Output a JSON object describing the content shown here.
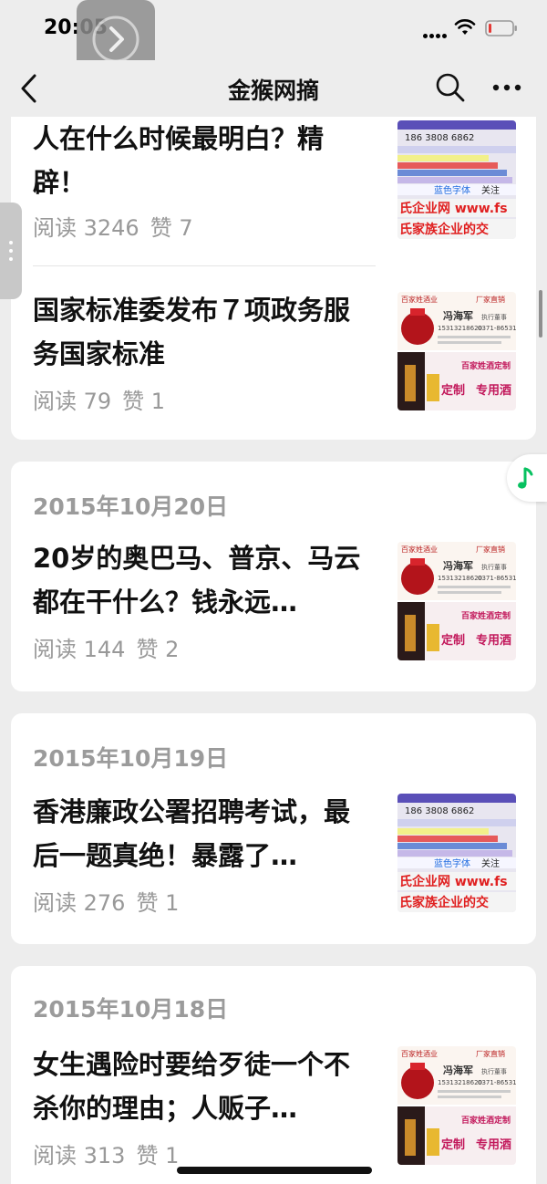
{
  "status": {
    "time": "20:05"
  },
  "nav": {
    "title": "金猴网摘"
  },
  "cards": [
    {
      "date": "",
      "articles": [
        {
          "title": "人在什么时候最明白？精辟！",
          "reads": "阅读 3246",
          "likes": "赞 7",
          "thumb": "ad-enterprise"
        },
        {
          "title": "国家标准委发布７项政务服务国家标准",
          "reads": "阅读 79",
          "likes": "赞 1",
          "thumb": "ad-liquor"
        }
      ]
    },
    {
      "date": "2015年10月20日",
      "articles": [
        {
          "title": "20岁的奥巴马、普京、马云都在干什么？钱永远…",
          "reads": "阅读 144",
          "likes": "赞 2",
          "thumb": "ad-liquor"
        }
      ]
    },
    {
      "date": "2015年10月19日",
      "articles": [
        {
          "title": "香港廉政公署招聘考试，最后一题真绝！暴露了…",
          "reads": "阅读 276",
          "likes": "赞 1",
          "thumb": "ad-enterprise"
        }
      ]
    },
    {
      "date": "2015年10月18日",
      "articles": [
        {
          "title": "女生遇险时要给歹徒一个不杀你的理由；人贩子…",
          "reads": "阅读 313",
          "likes": "赞 1",
          "thumb": "ad-liquor"
        }
      ]
    }
  ],
  "thumbs": {
    "enterprise": {
      "phone": "186 3808 6862",
      "blue_text": "蓝色字体",
      "follow": "关注",
      "banner1": "氏企业网 www.fs",
      "banner2": "氏家族企业的交"
    },
    "liquor": {
      "brand": "百家姓酒业",
      "badge": "厂家直销",
      "name": "冯海军",
      "role": "执行董事",
      "phone": "15313218620",
      "phone2": "0371-86531962",
      "custom": "百家姓酒定制",
      "slogan": "定制",
      "special": "专用酒"
    }
  },
  "colors": {
    "bg": "#ededed",
    "card": "#ffffff",
    "title": "#111111",
    "meta": "#999999",
    "accent": "#07c160"
  }
}
